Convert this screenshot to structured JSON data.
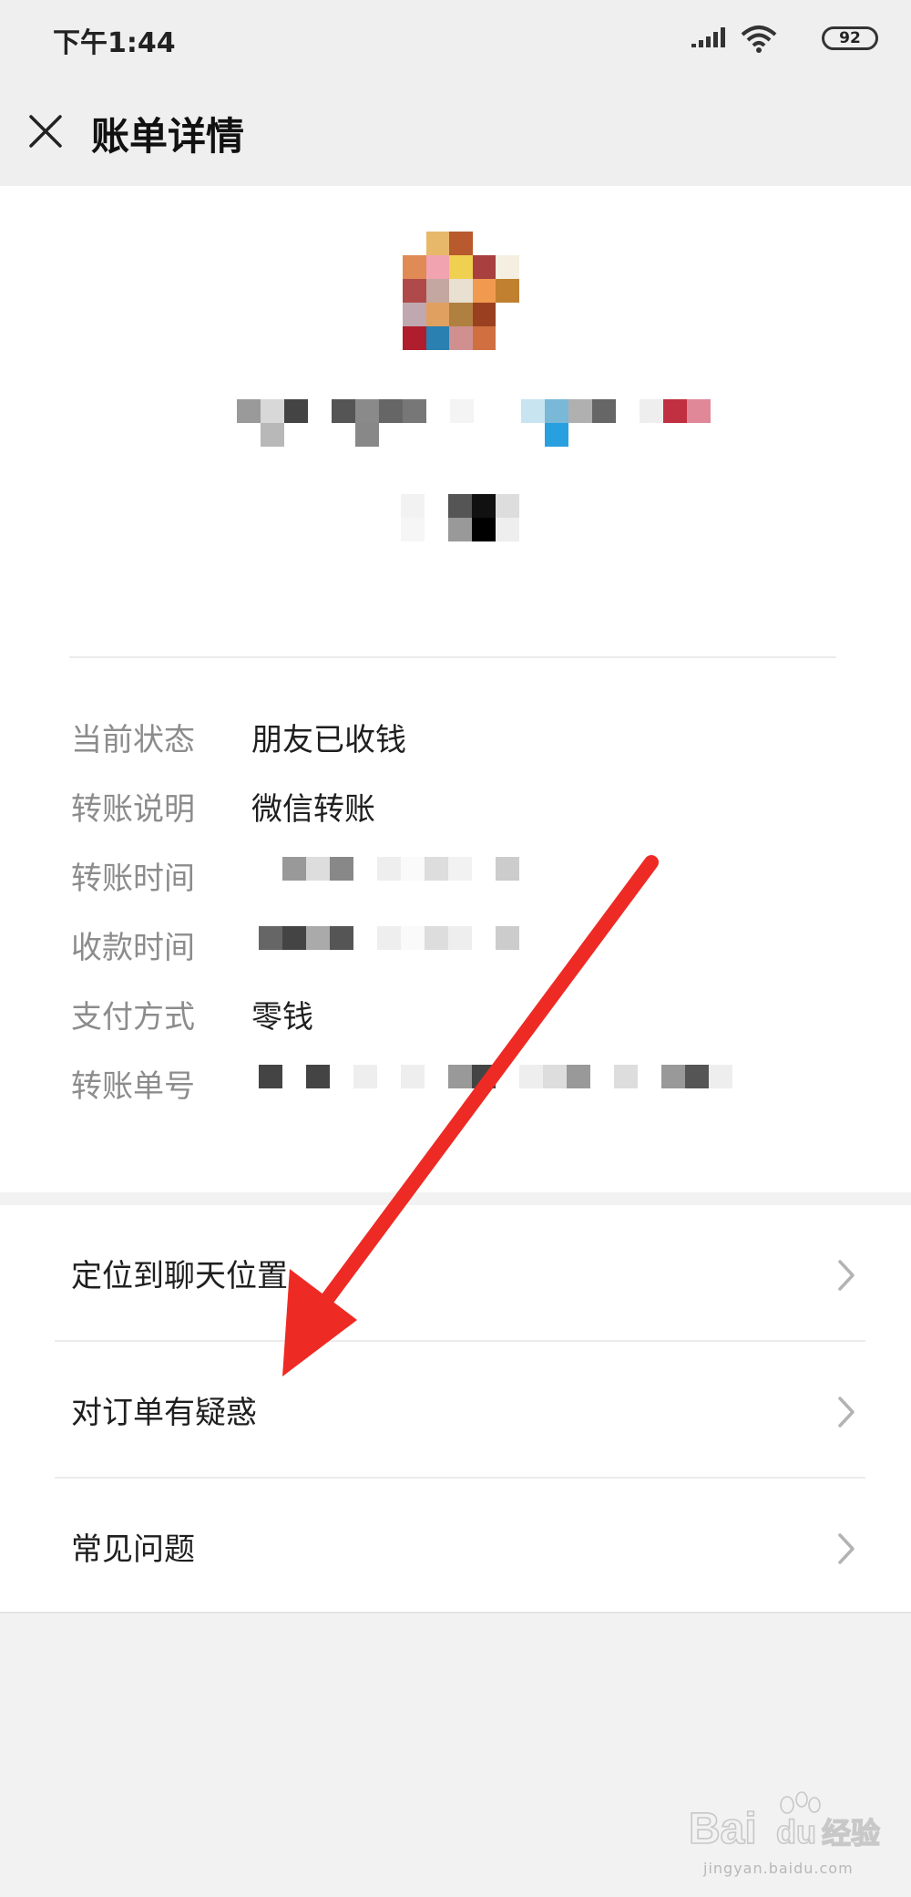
{
  "status_bar": {
    "time": "下午1:44",
    "battery": "92"
  },
  "header": {
    "title": "账单详情"
  },
  "details": [
    {
      "label": "当前状态",
      "value": "朋友已收钱"
    },
    {
      "label": "转账说明",
      "value": "微信转账"
    },
    {
      "label": "转账时间",
      "value": ""
    },
    {
      "label": "收款时间",
      "value": ""
    },
    {
      "label": "支付方式",
      "value": "零钱"
    },
    {
      "label": "转账单号",
      "value": ""
    }
  ],
  "menu": [
    {
      "label": "定位到聊天位置"
    },
    {
      "label": "对订单有疑惑"
    },
    {
      "label": "常见问题"
    }
  ],
  "watermark": {
    "url": "jingyan.baidu.com"
  },
  "colors": {
    "accent_arrow": "#ee2a24",
    "label_gray": "#8c8c8c",
    "background": "#f2f2f2"
  }
}
